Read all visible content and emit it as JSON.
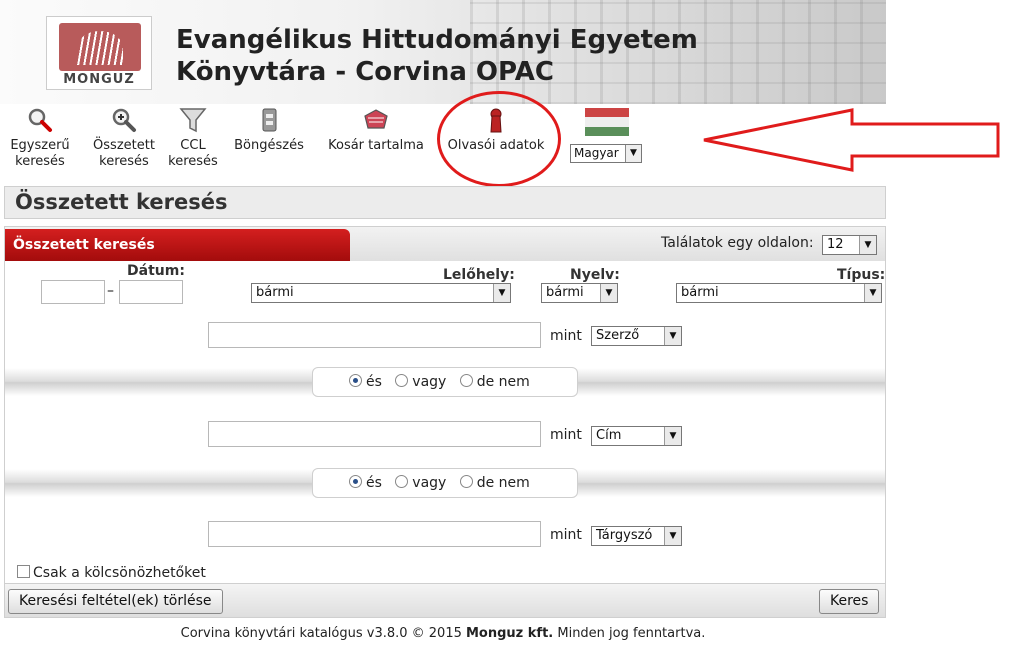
{
  "header": {
    "logo_text": "MONGUZ",
    "title_line1": "Evangélikus Hittudományi Egyetem",
    "title_line2": "Könyvtára - Corvina OPAC"
  },
  "toolbar": {
    "simple_search": [
      "Egyszerű",
      "keresés"
    ],
    "advanced_search": [
      "Összetett",
      "keresés"
    ],
    "ccl_search": [
      "CCL",
      "keresés"
    ],
    "browse": "Böngészés",
    "basket": "Kosár tartalma",
    "reader_data": "Olvasói adatok",
    "language": "Magyar"
  },
  "section_title": "Összetett keresés",
  "panel": {
    "tab_label": "Összetett keresés",
    "per_page_label": "Találatok egy oldalon:",
    "per_page_value": "12",
    "date_label": "Dátum:",
    "date_dash": "–",
    "location_label": "Lelőhely:",
    "location_value": "bármi",
    "language_label": "Nyelv:",
    "language_value": "bármi",
    "type_label": "Típus:",
    "type_value": "bármi",
    "mint_label": "mint",
    "rows": [
      {
        "field": "Szerző"
      },
      {
        "field": "Cím"
      },
      {
        "field": "Tárgyszó"
      }
    ],
    "bool": {
      "and": "és",
      "or": "vagy",
      "not": "de nem"
    },
    "only_loanable": "Csak a kölcsönözhetőket",
    "clear_button": "Keresési feltétel(ek) törlése",
    "search_button": "Keres"
  },
  "footer": {
    "prefix": "Corvina könyvtári katalógus v3.8.0 © 2015 ",
    "brand": "Monguz kft.",
    "suffix": " Minden jog fenntartva."
  },
  "colors": {
    "accent_red": "#c01414",
    "annotation_red": "#e01b1b"
  }
}
